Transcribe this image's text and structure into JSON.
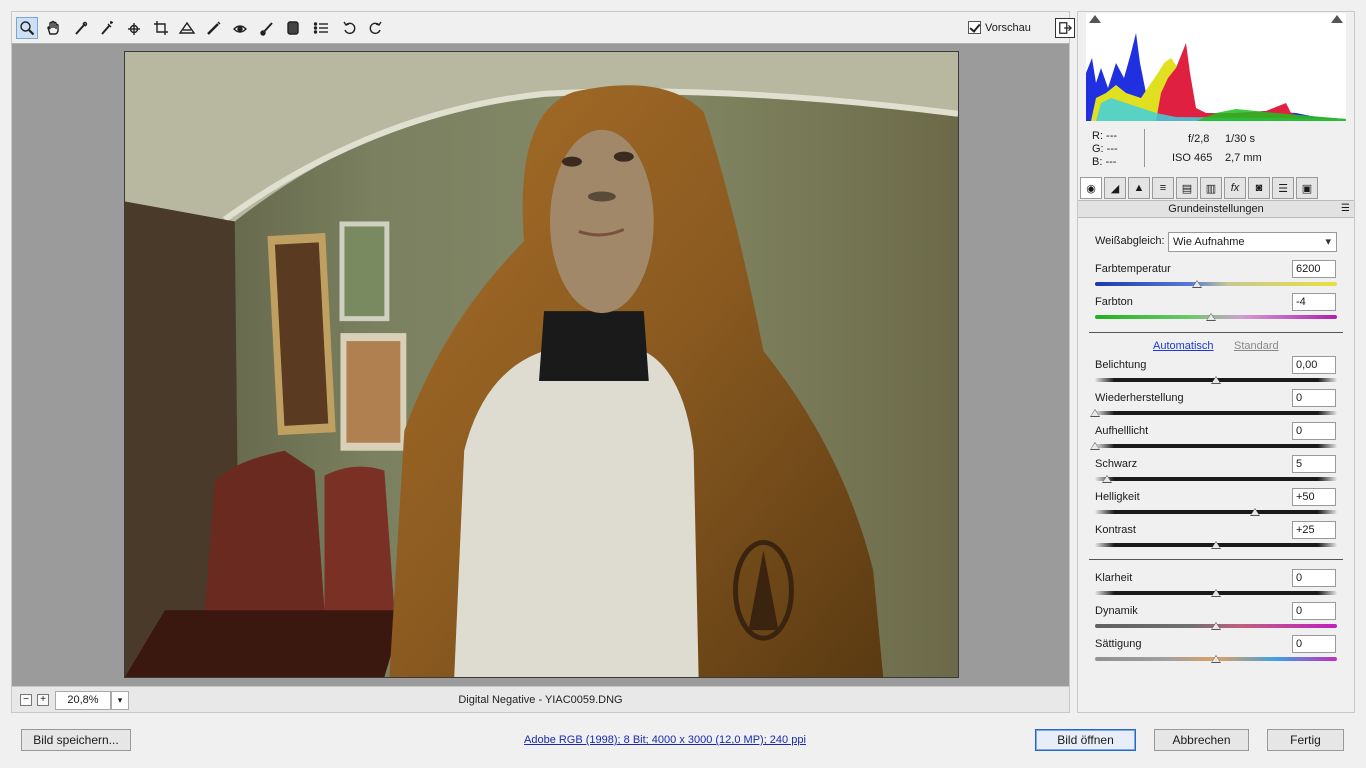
{
  "toolbar": {
    "tools": [
      "zoom-icon",
      "hand-icon",
      "white-balance-icon",
      "color-sampler-icon",
      "target-adjust-icon",
      "crop-icon",
      "straighten-icon",
      "spot-removal-icon",
      "red-eye-icon",
      "adjustment-brush-icon",
      "graduated-filter-icon",
      "preferences-icon",
      "rotate-left-icon",
      "rotate-right-icon"
    ],
    "preview_label": "Vorschau"
  },
  "status": {
    "zoom_minus": "−",
    "zoom_plus": "+",
    "zoom_value": "20,8%",
    "filename": "Digital Negative - YIAC0059.DNG"
  },
  "info": {
    "r": "R:   ---",
    "g": "G:   ---",
    "b": "B:   ---",
    "aperture": "f/2,8",
    "shutter": "1/30 s",
    "iso": "ISO 465",
    "focal": "2,7 mm"
  },
  "panel": {
    "title": "Grundeinstellungen",
    "tabs": [
      "basic-icon",
      "tone-curve-icon",
      "detail-icon",
      "hsl-icon",
      "split-toning-icon",
      "lens-corrections-icon",
      "effects-icon",
      "camera-calibration-icon",
      "presets-icon",
      "snapshots-icon"
    ],
    "wb_label": "Weißabgleich:",
    "wb_value": "Wie Aufnahme",
    "auto_label": "Automatisch",
    "standard_label": "Standard"
  },
  "sliders": {
    "temp": {
      "label": "Farbtemperatur",
      "value": "6200",
      "pos": 0.42
    },
    "tint": {
      "label": "Farbton",
      "value": "-4",
      "pos": 0.48
    },
    "exposure": {
      "label": "Belichtung",
      "value": "0,00",
      "pos": 0.5
    },
    "recovery": {
      "label": "Wiederherstellung",
      "value": "0",
      "pos": 0.0
    },
    "fill": {
      "label": "Aufhelllicht",
      "value": "0",
      "pos": 0.0
    },
    "black": {
      "label": "Schwarz",
      "value": "5",
      "pos": 0.05
    },
    "bright": {
      "label": "Helligkeit",
      "value": "+50",
      "pos": 0.66
    },
    "contrast": {
      "label": "Kontrast",
      "value": "+25",
      "pos": 0.5
    },
    "clarity": {
      "label": "Klarheit",
      "value": "0",
      "pos": 0.5
    },
    "vibrance": {
      "label": "Dynamik",
      "value": "0",
      "pos": 0.5
    },
    "saturation": {
      "label": "Sättigung",
      "value": "0",
      "pos": 0.5
    }
  },
  "bottom": {
    "save_label": "Bild speichern...",
    "info_link": "Adobe RGB (1998); 8 Bit; 4000 x 3000 (12,0 MP); 240 ppi",
    "open_label": "Bild öffnen",
    "cancel_label": "Abbrechen",
    "done_label": "Fertig"
  },
  "colors": {
    "accent": "#2a66c4",
    "link": "#1a3ad0"
  }
}
